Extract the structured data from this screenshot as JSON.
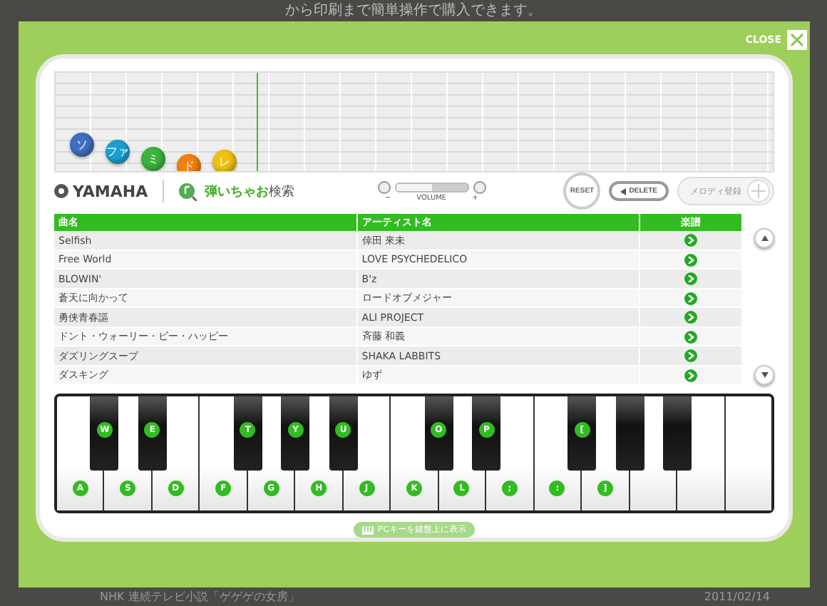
{
  "background": {
    "top_text": "から印刷まで簡単操作で購入できます。",
    "bottom_text": "NHK 連続テレビ小説「ゲゲゲの女房」",
    "date": "2011/02/14"
  },
  "close_label": "CLOSE",
  "notes": [
    {
      "label": "ソ",
      "color": "#3f6fbf"
    },
    {
      "label": "ファ",
      "color": "#1a9fd0"
    },
    {
      "label": "ミ",
      "color": "#3cb33c"
    },
    {
      "label": "ド",
      "color": "#f08010"
    },
    {
      "label": "レ",
      "color": "#f0c010"
    }
  ],
  "brand": "YAMAHA",
  "search_name": "弾いちゃお",
  "search_suffix": "検索",
  "volume": {
    "label": "VOLUME",
    "minus": "−",
    "plus": "+",
    "level": 0.5
  },
  "buttons": [
    {
      "kind": "reset",
      "label": "RESET",
      "disabled": false
    },
    {
      "kind": "delete",
      "label": "DELETE",
      "disabled": false
    },
    {
      "kind": "register",
      "label": "メロディ登録",
      "disabled": true
    }
  ],
  "table": {
    "columns": [
      "曲名",
      "アーティスト名",
      "楽譜"
    ],
    "rows": [
      {
        "title": "Selfish",
        "artist": "倖田 來未"
      },
      {
        "title": "Free World",
        "artist": "LOVE PSYCHEDELICO"
      },
      {
        "title": "BLOWIN'",
        "artist": "B'z"
      },
      {
        "title": "蒼天に向かって",
        "artist": "ロードオブメジャー"
      },
      {
        "title": "勇侠青春謳",
        "artist": "ALI PROJECT"
      },
      {
        "title": "ドント・ウォーリー・ビー・ハッピー",
        "artist": "斉藤 和義"
      },
      {
        "title": "ダズリングスープ",
        "artist": "SHAKA LABBITS"
      },
      {
        "title": "ダスキング",
        "artist": "ゆず"
      }
    ]
  },
  "keyboard": {
    "white_keys": [
      "A",
      "S",
      "D",
      "F",
      "G",
      "H",
      "J",
      "K",
      "L",
      ";",
      ":",
      "]"
    ],
    "black_keys": [
      "W",
      "E",
      "T",
      "Y",
      "U",
      "O",
      "P",
      "["
    ]
  },
  "toggle_label": "PCキーを鍵盤上に表示"
}
